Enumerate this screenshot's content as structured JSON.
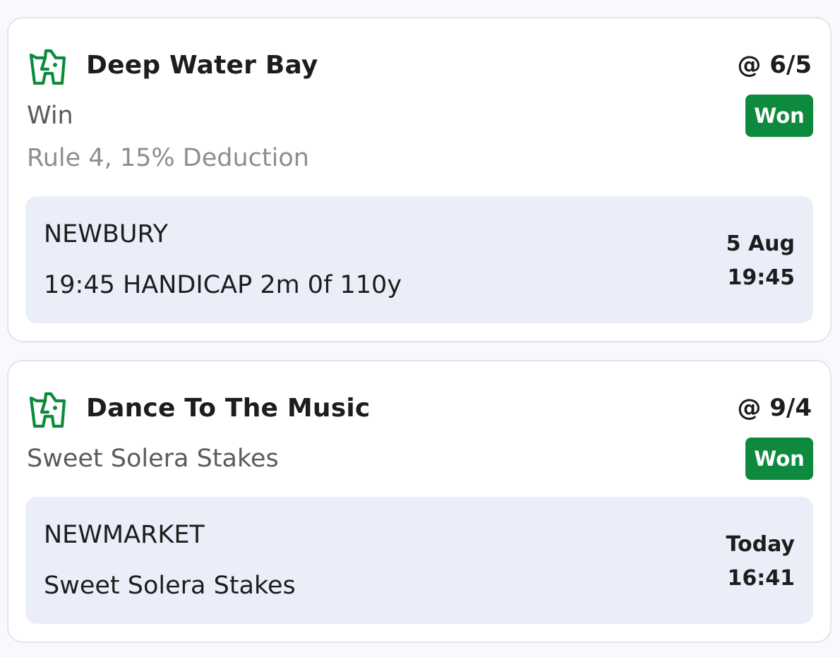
{
  "colors": {
    "page_background": "#f8f9fc",
    "card_background": "#ffffff",
    "card_border": "#e3e5ea",
    "event_panel": "#e9eef8",
    "won_badge": "#0d8a3e",
    "brand_green": "#0d8a3e",
    "primary_text": "#1d1d1d",
    "secondary_text": "#5b5b5b",
    "muted_text": "#8e8e8e"
  },
  "bets": [
    {
      "icon": "horse-racing-icon",
      "selection": "Deep Water Bay",
      "odds": "@ 6/5",
      "market": "Win",
      "rule": "Rule 4, 15% Deduction",
      "status": "Won",
      "event": {
        "venue": "NEWBURY",
        "race": "19:45 HANDICAP 2m 0f 110y",
        "date": "5 Aug",
        "time": "19:45"
      }
    },
    {
      "icon": "horse-racing-icon",
      "selection": "Dance To The Music",
      "odds": "@ 9/4",
      "market": "Sweet Solera Stakes",
      "status": "Won",
      "event": {
        "venue": "NEWMARKET",
        "race": "Sweet Solera Stakes",
        "date": "Today",
        "time": "16:41"
      }
    }
  ]
}
